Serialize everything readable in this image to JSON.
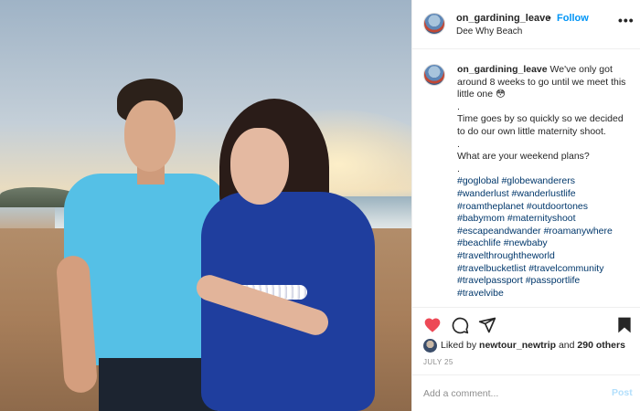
{
  "post": {
    "username": "on_gardining_leave",
    "follow_label": "Follow",
    "separator": "•",
    "location": "Dee Why Beach",
    "more_label": "•••"
  },
  "caption": {
    "username": "on_gardining_leave",
    "lines": [
      "We've only got around 8 weeks to go until we meet this little one 😳",
      ".",
      "Time goes by so quickly so we decided to do our own little maternity shoot.",
      ".",
      "What are your weekend plans?",
      "."
    ],
    "hashtag_lines": [
      "#goglobal #globewanderers",
      "#wanderlust #wanderlustlife",
      "#roamtheplanet #outdoortones",
      "#babymom #maternityshoot",
      "#escapeandwander #roamanywhere",
      "#beachlife #newbaby",
      "#travelthroughtheworld",
      "#travelbucketlist #travelcommunity",
      "#travelpassport #passportlife",
      "#travelvibe"
    ]
  },
  "likes": {
    "prefix": "Liked by",
    "user": "newtour_newtrip",
    "joiner": "and",
    "others": "290 others"
  },
  "date": "JULY 25",
  "comment": {
    "placeholder": "Add a comment...",
    "post_label": "Post"
  },
  "icons": {
    "like": "heart-icon",
    "comment": "comment-icon",
    "share": "share-icon",
    "save": "bookmark-icon"
  },
  "colors": {
    "like_red": "#ed4956",
    "follow_blue": "#0095f6",
    "hashtag_blue": "#00376b",
    "post_disabled": "#b2dffc"
  }
}
